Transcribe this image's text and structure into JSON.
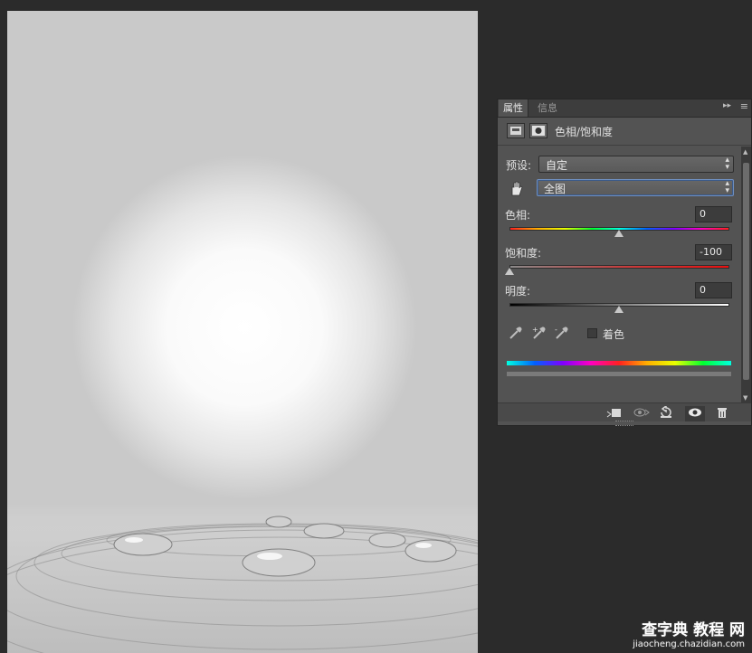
{
  "panel": {
    "tabs": [
      {
        "label": "属性"
      },
      {
        "label": "信息"
      }
    ],
    "menu_collapse": "▸▸",
    "menu_icon": "≡",
    "title": "色相/饱和度",
    "preset_label": "预设:",
    "preset_value": "自定",
    "channel_value": "全图",
    "hue": {
      "label": "色相:",
      "value": "0"
    },
    "saturation": {
      "label": "饱和度:",
      "value": "-100"
    },
    "lightness": {
      "label": "明度:",
      "value": "0"
    },
    "colorize_label": "着色",
    "icons": [
      "layer-mask-icon",
      "hand-adjust-icon",
      "eyedropper-icon",
      "eyedropper-plus-icon",
      "eyedropper-minus-icon",
      "clip-to-layer-icon",
      "view-previous-icon",
      "reset-icon",
      "visibility-eye-icon",
      "trash-icon"
    ]
  },
  "watermark": {
    "line1": "查字典 教程 网",
    "line2": "jiaocheng.chazidian.com"
  },
  "colors": {
    "panel_bg": "#535353",
    "workspace_bg": "#2b2b2b"
  }
}
